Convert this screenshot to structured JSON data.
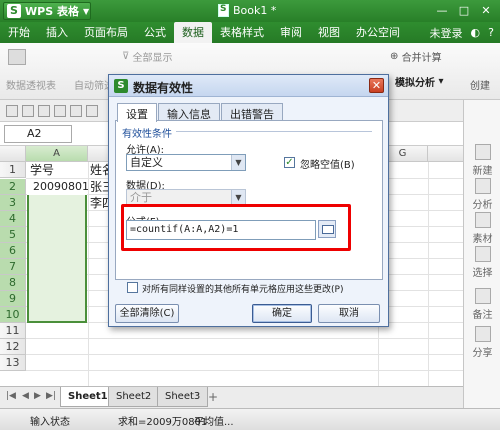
{
  "title_bar": {
    "app_name": "WPS 表格",
    "doc_name": "Book1 *"
  },
  "menu": {
    "items": [
      "开始",
      "插入",
      "页面布局",
      "公式",
      "数据",
      "表格样式",
      "审阅",
      "视图",
      "办公空间"
    ],
    "active": "数据",
    "login": "未登录"
  },
  "ribbon": {
    "pivot": "数据透视表",
    "autofilter": "自动筛选",
    "show_all": "全部显示",
    "merge_calc": "合并计算",
    "what_if": "模拟分析",
    "create_group": "创建"
  },
  "name_box": "A2",
  "columns": [
    "A",
    "G"
  ],
  "rows": [
    "1",
    "2",
    "3",
    "4",
    "5",
    "6",
    "7",
    "8",
    "9",
    "10",
    "11",
    "12",
    "13"
  ],
  "cells": {
    "a1": "学号",
    "b1": "姓名",
    "a2": "20090801",
    "b2": "张三",
    "b3": "李四"
  },
  "sheets": [
    "Sheet1",
    "Sheet2",
    "Sheet3"
  ],
  "active_sheet": "Sheet1",
  "status": {
    "mode": "输入状态",
    "sum": "求和=2009万0801",
    "average": "平均值..."
  },
  "task_pane": [
    "新建",
    "分析",
    "素材",
    "选择",
    "备注",
    "分享"
  ],
  "dialog": {
    "title": "数据有效性",
    "tabs": [
      "设置",
      "输入信息",
      "出错警告"
    ],
    "active_tab": "设置",
    "group_title": "有效性条件",
    "allow_label": "允许(A):",
    "allow_value": "自定义",
    "ignore_blank_label": "忽略空值(B)",
    "ignore_blank_checked": true,
    "data_label": "数据(D):",
    "data_value": "介于",
    "formula_label": "公式(F):",
    "formula_value": "=countif(A:A,A2)=1",
    "apply_all_label": "对所有同样设置的其他所有单元格应用这些更改(P)",
    "apply_all_checked": false,
    "clear_all": "全部清除(C)",
    "ok": "确定",
    "cancel": "取消"
  },
  "colors": {
    "title_green": "#2d8a2d",
    "selection_border": "#4a8f3a",
    "highlight_red": "#e00000"
  }
}
